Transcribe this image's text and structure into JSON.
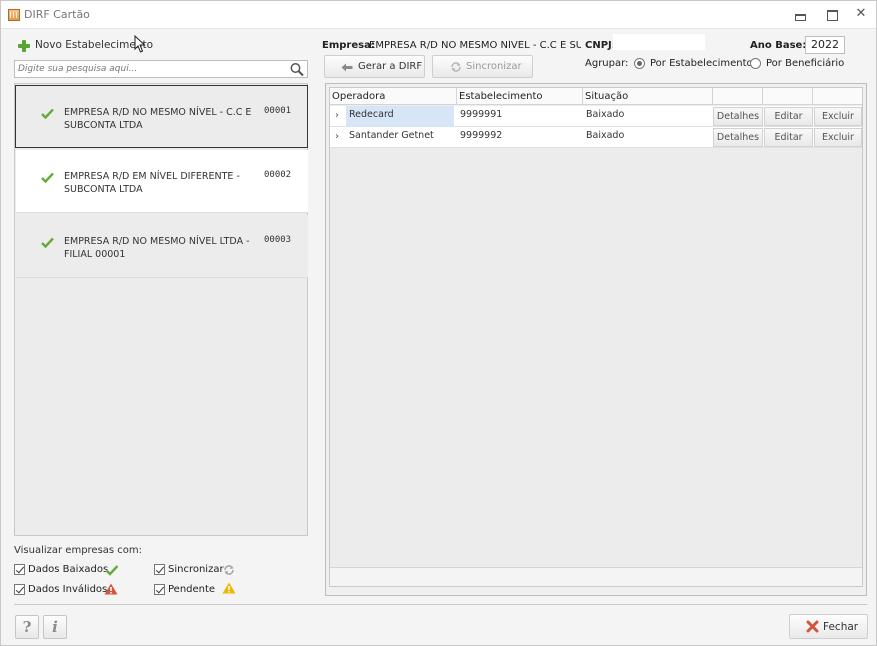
{
  "window": {
    "title": "DIRF Cartão",
    "icons": {
      "app": "calculator-icon",
      "minimize": "minimize-icon",
      "maximize": "maximize-icon",
      "close": "close-icon"
    }
  },
  "left": {
    "new_button": "Novo Estabelecimento",
    "search_placeholder": "Digite sua pesquisa aqui...",
    "companies": [
      {
        "name": "EMPRESA R/D NO MESMO NÍVEL - C.C E SUBCONTA LTDA",
        "code": "00001",
        "selected": true
      },
      {
        "name": "EMPRESA R/D EM NÍVEL DIFERENTE - SUBCONTA LTDA",
        "code": "00002",
        "selected": false
      },
      {
        "name": "EMPRESA R/D NO MESMO NÍVEL LTDA - FILIAL 00001",
        "code": "00003",
        "selected": false
      }
    ],
    "legend_title": "Visualizar empresas com:",
    "legend": {
      "baixados": "Dados Baixados",
      "invalidos": "Dados Inválidos",
      "sincronizar": "Sincronizar",
      "pendente": "Pendente"
    }
  },
  "header": {
    "empresa_label": "Empresa:",
    "empresa_value": "EMPRESA R/D NO MESMO NÍVEL - C.C E SUBCONTA LTDA",
    "cnpj_label": "CNPJ:",
    "ano_label": "Ano Base:",
    "ano_value": "2022",
    "gerar_button": "Gerar a DIRF",
    "sync_button": "Sincronizar",
    "agrupar_label": "Agrupar:",
    "radio_estabelecimento": "Por Estabelecimento",
    "radio_beneficiario": "Por Beneficiário"
  },
  "grid": {
    "columns": [
      "Operadora",
      "Estabelecimento",
      "Situação"
    ],
    "rows": [
      {
        "operadora": "Redecard",
        "estabelecimento": "9999991",
        "situacao": "Baixado"
      },
      {
        "operadora": "Santander Getnet",
        "estabelecimento": "9999992",
        "situacao": "Baixado"
      }
    ],
    "actions": {
      "detalhes": "Detalhes",
      "editar": "Editar",
      "excluir": "Excluir"
    }
  },
  "footer": {
    "help": "?",
    "info": "i",
    "fechar": "Fechar"
  },
  "colors": {
    "check_green": "#6aa83a",
    "warning_red": "#d2563b",
    "warning_yellow": "#f2b600",
    "selection_blue": "#d7e6f6"
  }
}
